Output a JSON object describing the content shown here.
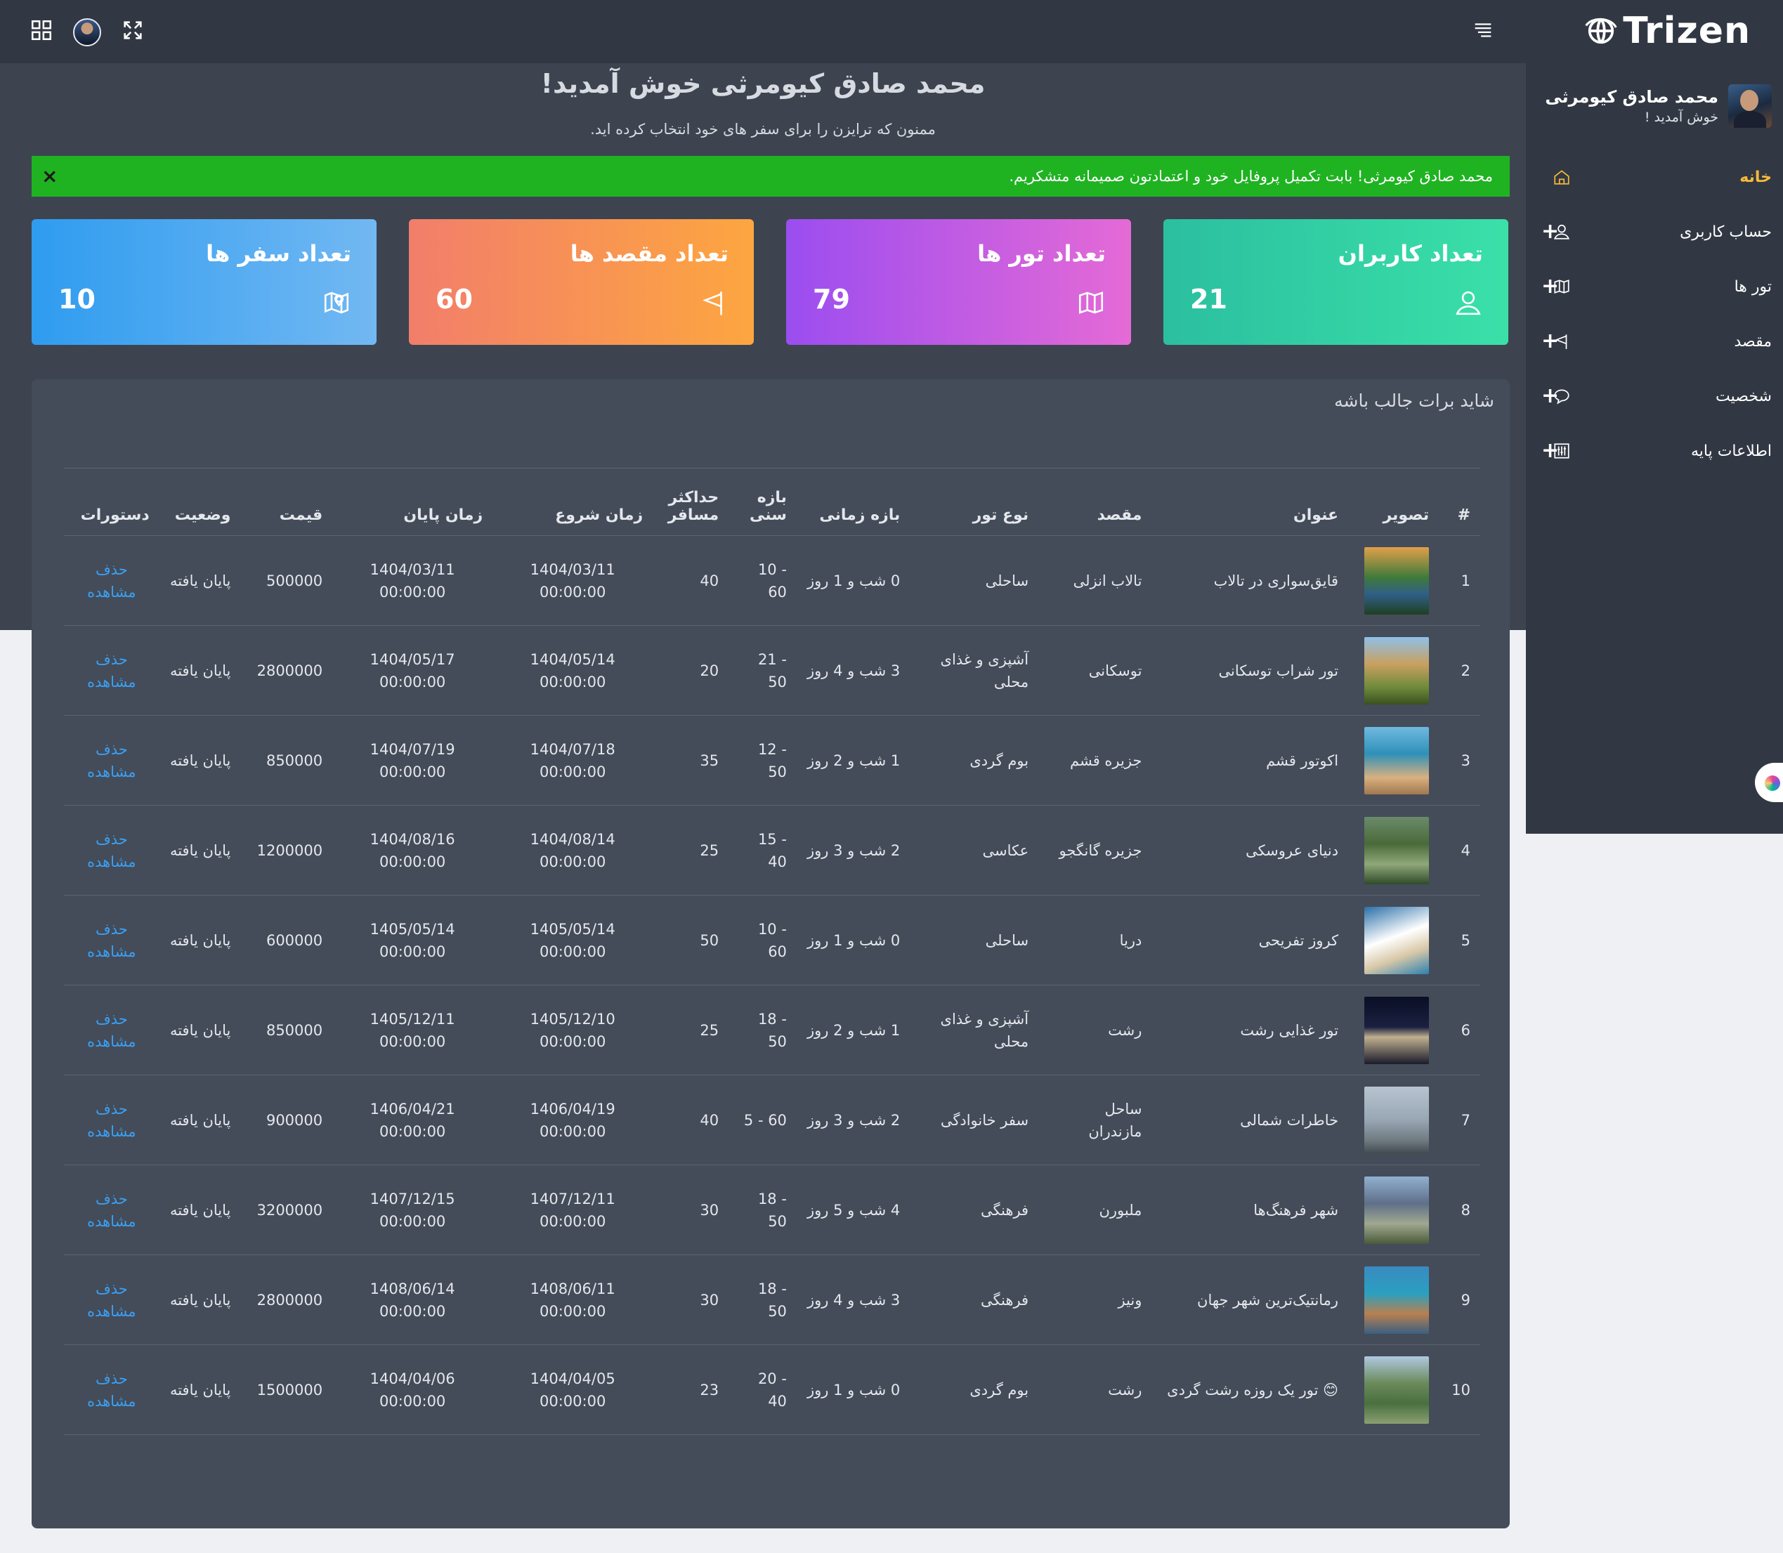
{
  "brand": {
    "name": "Trizen"
  },
  "topbar": {
    "icons": [
      "grid-icon",
      "avatar",
      "fullscreen-icon",
      "menu-icon"
    ]
  },
  "sidebar": {
    "profile": {
      "name": "محمد صادق کیومرثی",
      "greeting": "خوش آمدید !"
    },
    "items": [
      {
        "label": "خانه",
        "icon": "home-icon",
        "active": true,
        "expandable": false
      },
      {
        "label": "حساب کاربری",
        "icon": "user-icon",
        "active": false,
        "expandable": true,
        "plus": "+"
      },
      {
        "label": "تور ها",
        "icon": "map-icon",
        "active": false,
        "expandable": true,
        "plus": "+"
      },
      {
        "label": "مقصد",
        "icon": "flag-icon",
        "active": false,
        "expandable": true,
        "plus": "+"
      },
      {
        "label": "شخصیت",
        "icon": "chat-icon",
        "active": false,
        "expandable": true,
        "plus": "+"
      },
      {
        "label": "اطلاعات پایه",
        "icon": "sliders-icon",
        "active": false,
        "expandable": true,
        "plus": "+"
      }
    ]
  },
  "welcome": {
    "title": "محمد صادق کیومرثی خوش آمدید!",
    "subtitle": "ممنون که ترایزن را برای سفر های خود انتخاب کرده اید."
  },
  "alert": {
    "text": "محمد صادق کیومرثی! بابت تکمیل پروفایل خود و اعتمادتون صمیمانه متشکریم.",
    "close": "×"
  },
  "stats": [
    {
      "title": "تعداد کاربران",
      "value": "21",
      "icon": "user-icon",
      "gradient": [
        "#2bbfa0",
        "#3ae0a8"
      ]
    },
    {
      "title": "تعداد تور ها",
      "value": "79",
      "icon": "map-icon",
      "gradient": [
        "#9b4df0",
        "#e56ad6"
      ]
    },
    {
      "title": "تعداد مقصد ها",
      "value": "60",
      "icon": "flag-icon",
      "gradient": [
        "#f27e6a",
        "#fda640"
      ]
    },
    {
      "title": "تعداد سفر ها",
      "value": "10",
      "icon": "map-pin-icon",
      "gradient": [
        "#2f9cf0",
        "#72b8f2"
      ]
    }
  ],
  "table": {
    "title": "شاید برات جالب باشه",
    "headers": [
      "#",
      "تصویر",
      "عنوان",
      "مقصد",
      "نوع تور",
      "بازه زمانی",
      "بازه سنی",
      "حداکثر مسافر",
      "زمان شروع",
      "زمان پایان",
      "قیمت",
      "وضعیت",
      "دستورات"
    ],
    "rows": [
      {
        "n": "1",
        "title": "قایق‌سواری در تالاب",
        "dest": "تالاب انزلی",
        "type": "ساحلی",
        "duration": "0 شب و 1 روز",
        "age": "10 - 60",
        "max": "40",
        "start_date": "1404/03/11",
        "start_time": "00:00:00",
        "end_date": "1404/03/11",
        "end_time": "00:00:00",
        "price": "500000",
        "status": "پایان یافته",
        "del": "حذف",
        "view": "مشاهده"
      },
      {
        "n": "2",
        "title": "تور شراب توسکانی",
        "dest": "توسکانی",
        "type": "آشپزی و غذای محلی",
        "duration": "3 شب و 4 روز",
        "age": "21 - 50",
        "max": "20",
        "start_date": "1404/05/14",
        "start_time": "00:00:00",
        "end_date": "1404/05/17",
        "end_time": "00:00:00",
        "price": "2800000",
        "status": "پایان یافته",
        "del": "حذف",
        "view": "مشاهده"
      },
      {
        "n": "3",
        "title": "اکوتور قشم",
        "dest": "جزیره قشم",
        "type": "بوم گردی",
        "duration": "1 شب و 2 روز",
        "age": "12 - 50",
        "max": "35",
        "start_date": "1404/07/18",
        "start_time": "00:00:00",
        "end_date": "1404/07/19",
        "end_time": "00:00:00",
        "price": "850000",
        "status": "پایان یافته",
        "del": "حذف",
        "view": "مشاهده"
      },
      {
        "n": "4",
        "title": "دنیای عروسکی",
        "dest": "جزیره گانگجو",
        "type": "عکاسی",
        "duration": "2 شب و 3 روز",
        "age": "15 - 40",
        "max": "25",
        "start_date": "1404/08/14",
        "start_time": "00:00:00",
        "end_date": "1404/08/16",
        "end_time": "00:00:00",
        "price": "1200000",
        "status": "پایان یافته",
        "del": "حذف",
        "view": "مشاهده"
      },
      {
        "n": "5",
        "title": "کروز تفریحی",
        "dest": "دریا",
        "type": "ساحلی",
        "duration": "0 شب و 1 روز",
        "age": "10 - 60",
        "max": "50",
        "start_date": "1405/05/14",
        "start_time": "00:00:00",
        "end_date": "1405/05/14",
        "end_time": "00:00:00",
        "price": "600000",
        "status": "پایان یافته",
        "del": "حذف",
        "view": "مشاهده"
      },
      {
        "n": "6",
        "title": "تور غذایی رشت",
        "dest": "رشت",
        "type": "آشپزی و غذای محلی",
        "duration": "1 شب و 2 روز",
        "age": "18 - 50",
        "max": "25",
        "start_date": "1405/12/10",
        "start_time": "00:00:00",
        "end_date": "1405/12/11",
        "end_time": "00:00:00",
        "price": "850000",
        "status": "پایان یافته",
        "del": "حذف",
        "view": "مشاهده"
      },
      {
        "n": "7",
        "title": "خاطرات شمالی",
        "dest": "ساحل مازندران",
        "type": "سفر خانوادگی",
        "duration": "2 شب و 3 روز",
        "age": "5 - 60",
        "max": "40",
        "start_date": "1406/04/19",
        "start_time": "00:00:00",
        "end_date": "1406/04/21",
        "end_time": "00:00:00",
        "price": "900000",
        "status": "پایان یافته",
        "del": "حذف",
        "view": "مشاهده"
      },
      {
        "n": "8",
        "title": "شهر فرهنگ‌ها",
        "dest": "ملبورن",
        "type": "فرهنگی",
        "duration": "4 شب و 5 روز",
        "age": "18 - 50",
        "max": "30",
        "start_date": "1407/12/11",
        "start_time": "00:00:00",
        "end_date": "1407/12/15",
        "end_time": "00:00:00",
        "price": "3200000",
        "status": "پایان یافته",
        "del": "حذف",
        "view": "مشاهده"
      },
      {
        "n": "9",
        "title": "رمانتیک‌ترین شهر جهان",
        "dest": "ونیز",
        "type": "فرهنگی",
        "duration": "3 شب و 4 روز",
        "age": "18 - 50",
        "max": "30",
        "start_date": "1408/06/11",
        "start_time": "00:00:00",
        "end_date": "1408/06/14",
        "end_time": "00:00:00",
        "price": "2800000",
        "status": "پایان یافته",
        "del": "حذف",
        "view": "مشاهده"
      },
      {
        "n": "10",
        "title": "😊 تور یک روزه رشت گردی",
        "dest": "رشت",
        "type": "بوم گردی",
        "duration": "0 شب و 1 روز",
        "age": "20 - 40",
        "max": "23",
        "start_date": "1404/04/05",
        "start_time": "00:00:00",
        "end_date": "1404/04/06",
        "end_time": "00:00:00",
        "price": "1500000",
        "status": "پایان یافته",
        "del": "حذف",
        "view": "مشاهده"
      }
    ]
  },
  "colors": {
    "alert_bg": "#1fb322",
    "active_nav": "#f6b93b",
    "link": "#3aa0f5",
    "panel_bg": "#444c59",
    "sidebar_bg": "#323843"
  }
}
